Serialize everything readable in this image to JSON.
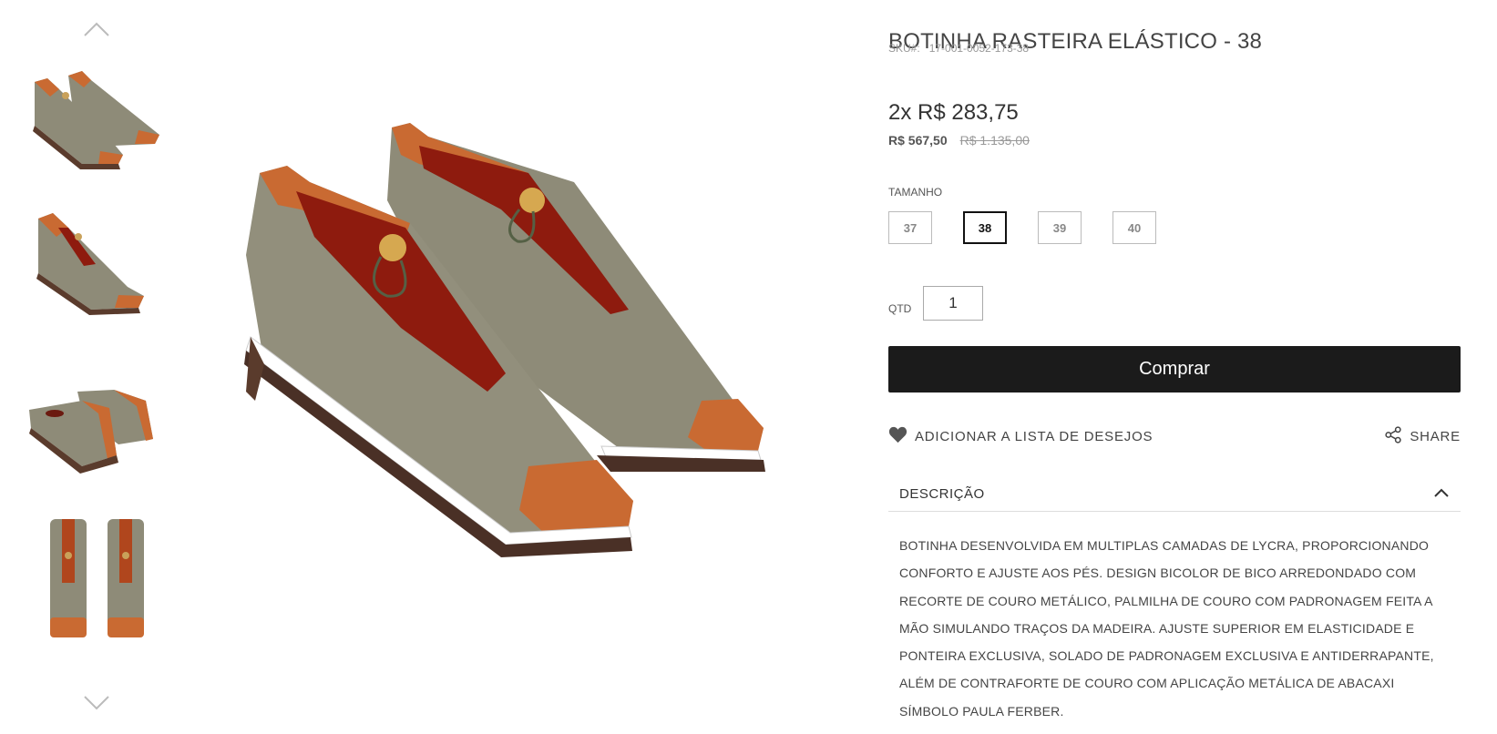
{
  "product": {
    "title": "BOTINHA RASTEIRA ELÁSTICO - 38",
    "sku_label": "SKU#:",
    "sku_value": "17-001-0052-173-38",
    "installments": "2x R$ 283,75",
    "price": "R$ 567,50",
    "old_price": "R$ 1.135,00"
  },
  "size": {
    "label": "TAMANHO",
    "options": [
      "37",
      "38",
      "39",
      "40"
    ],
    "selected": "38"
  },
  "quantity": {
    "label": "QTD",
    "value": "1"
  },
  "actions": {
    "buy_label": "Comprar",
    "wishlist_label": "ADICIONAR A LISTA DE DESEJOS",
    "share_label": "SHARE"
  },
  "description": {
    "title": "DESCRIÇÃO",
    "text": "BOTINHA DESENVOLVIDA EM MULTIPLAS CAMADAS DE LYCRA, PROPORCIONANDO CONFORTO E AJUSTE AOS PÉS. DESIGN BICOLOR DE BICO ARREDONDADO COM RECORTE DE COURO METÁLICO, PALMILHA DE COURO COM PADRONAGEM FEITA A MÃO SIMULANDO TRAÇOS DA MADEIRA. AJUSTE SUPERIOR EM ELASTICIDADE E PONTEIRA EXCLUSIVA, SOLADO DE PADRONAGEM EXCLUSIVA E ANTIDERRAPANTE, ALÉM DE CONTRAFORTE DE COURO COM APLICAÇÃO METÁLICA DE ABACAXI SÍMBOLO PAULA FERBER."
  },
  "icons": {
    "gallery_up": "chevron-up-icon",
    "gallery_down": "chevron-down-icon",
    "wishlist": "heart-icon",
    "share": "share-icon",
    "collapse": "chevron-up-icon"
  },
  "colors": {
    "buy_button": "#1b1b1b",
    "shoe_body": "#8e8b78",
    "leather": "#c96a32",
    "lining": "#8e1b0e"
  }
}
